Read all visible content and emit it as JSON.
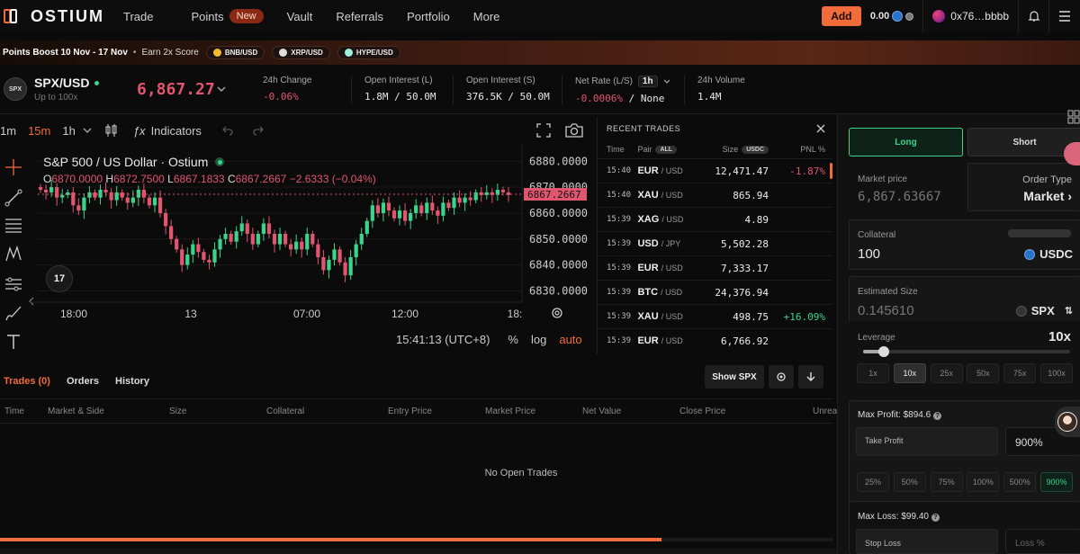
{
  "nav": {
    "logo": "OSTIUM",
    "items": [
      "Trade",
      "Points",
      "Vault",
      "Referrals",
      "Portfolio",
      "More"
    ],
    "new_badge": "New",
    "add_label": "Add",
    "balance": "0.00",
    "wallet": "0x76…bbbb"
  },
  "promo": {
    "title": "Points Boost 10 Nov - 17 Nov",
    "subtitle": "Earn 2x Score",
    "pairs": [
      "BNB/USD",
      "XRP/USD",
      "HYPE/USD"
    ]
  },
  "market": {
    "icon_text": "SPX",
    "pair": "SPX/USD",
    "leverage_note": "Up to 100x",
    "price": "6,867.27",
    "stats": [
      {
        "label": "24h Change",
        "value": "-0.06%"
      },
      {
        "label": "Open Interest (L)",
        "value": "1.8M / 50.0M"
      },
      {
        "label": "Open Interest (S)",
        "value": "376.5K / 50.0M"
      },
      {
        "label": "Net Rate (L/S)",
        "value_neg": "-0.0006%",
        "value_rest": " / None",
        "timeframe": "1h"
      },
      {
        "label": "24h Volume",
        "value": "1.4M"
      }
    ]
  },
  "chart_toolbar": {
    "intervals": [
      "1m",
      "15m",
      "1h"
    ],
    "indicators": "Indicators"
  },
  "chart": {
    "title": "S&P 500 / US Dollar · Ostium",
    "ohlc": {
      "o_label": "O",
      "o": "6870.0000",
      "h_label": "H",
      "h": "6872.7500",
      "l_label": "L",
      "l": "6867.1833",
      "c_label": "C",
      "c": "6867.2667",
      "chg": "−2.6333 (−0.04%)"
    },
    "last_price_tag": "6867.2667",
    "x_ticks": [
      "18:00",
      "13",
      "07:00",
      "12:00",
      "18:"
    ],
    "footer_time": "15:41:13 (UTC+8)",
    "footer_pct": "%",
    "footer_log": "log",
    "footer_auto": "auto",
    "tv_logo": "17"
  },
  "chart_data": {
    "type": "candlestick",
    "title": "S&P 500 / US Dollar · Ostium",
    "y_ticks": [
      6880,
      6870,
      6860,
      6850,
      6840,
      6830
    ],
    "ylim": [
      6826,
      6886
    ],
    "close_series": [
      6869,
      6868,
      6870,
      6866,
      6867,
      6868,
      6863,
      6861,
      6866,
      6868,
      6866,
      6869,
      6868,
      6865,
      6868,
      6866,
      6864,
      6866,
      6869,
      6866,
      6863,
      6866,
      6860,
      6855,
      6850,
      6846,
      6840,
      6844,
      6848,
      6845,
      6842,
      6841,
      6846,
      6850,
      6852,
      6849,
      6853,
      6856,
      6852,
      6848,
      6852,
      6856,
      6852,
      6848,
      6852,
      6848,
      6846,
      6849,
      6846,
      6852,
      6848,
      6843,
      6838,
      6842,
      6846,
      6841,
      6836,
      6843,
      6848,
      6852,
      6857,
      6863,
      6860,
      6864,
      6861,
      6858,
      6861,
      6857,
      6860,
      6863,
      6860,
      6864,
      6861,
      6859,
      6864,
      6862,
      6866,
      6864,
      6866,
      6865,
      6868,
      6867,
      6868,
      6867,
      6869,
      6868,
      6867
    ]
  },
  "recent_trades": {
    "title": "RECENT TRADES",
    "cols": {
      "time": "Time",
      "pair": "Pair",
      "all_chip": "ALL",
      "size": "Size",
      "usdc_chip": "USDC",
      "pnl": "PNL %"
    },
    "rows": [
      {
        "time": "15:40",
        "base": "EUR",
        "quote": "/ USD",
        "size": "12,471.47",
        "pnl": "-1.87%",
        "dir": "neg"
      },
      {
        "time": "15:40",
        "base": "XAU",
        "quote": "/ USD",
        "size": "865.94",
        "pnl": "",
        "dir": ""
      },
      {
        "time": "15:39",
        "base": "XAG",
        "quote": "/ USD",
        "size": "4.89",
        "pnl": "",
        "dir": ""
      },
      {
        "time": "15:39",
        "base": "USD",
        "quote": "/ JPY",
        "size": "5,502.28",
        "pnl": "",
        "dir": ""
      },
      {
        "time": "15:39",
        "base": "EUR",
        "quote": "/ USD",
        "size": "7,333.17",
        "pnl": "",
        "dir": ""
      },
      {
        "time": "15:39",
        "base": "BTC",
        "quote": "/ USD",
        "size": "24,376.94",
        "pnl": "",
        "dir": ""
      },
      {
        "time": "15:39",
        "base": "XAU",
        "quote": "/ USD",
        "size": "498.75",
        "pnl": "+16.09%",
        "dir": "pos"
      },
      {
        "time": "15:39",
        "base": "EUR",
        "quote": "/ USD",
        "size": "6,766.92",
        "pnl": "",
        "dir": ""
      }
    ]
  },
  "bottom": {
    "tabs": [
      "Trades (0)",
      "Orders",
      "History"
    ],
    "show_btn": "Show SPX",
    "columns": [
      "Time",
      "Market & Side",
      "Size",
      "Collateral",
      "Entry Price",
      "Market Price",
      "Net Value",
      "Close Price",
      "Unrea"
    ],
    "empty": "No Open Trades",
    "progress": 0.795
  },
  "panel": {
    "long": "Long",
    "short": "Short",
    "market_price_label": "Market price",
    "market_price": "6,867.63667",
    "order_type_label": "Order Type",
    "order_type": "Market",
    "collateral_label": "Collateral",
    "collateral": "100",
    "collateral_ccy": "USDC",
    "est_size_label": "Estimated Size",
    "est_size": "0.145610",
    "est_size_ccy": "SPX",
    "leverage_label": "Leverage",
    "leverage": "10x",
    "leverage_fraction": 0.1,
    "leverage_opts": [
      "1x",
      "10x",
      "25x",
      "50x",
      "75x",
      "100x"
    ],
    "max_profit": "Max Profit: $894.6",
    "take_profit_label": "Take Profit",
    "take_profit_value": "900%",
    "tp_opts": [
      "25%",
      "50%",
      "75%",
      "100%",
      "500%",
      "900%"
    ],
    "max_loss": "Max Loss: $99.40",
    "stop_loss_label": "Stop Loss",
    "loss_pct_placeholder": "Loss %"
  },
  "colors": {
    "accent": "#f26b3a",
    "up": "#3ad48c",
    "down": "#e0566f"
  }
}
